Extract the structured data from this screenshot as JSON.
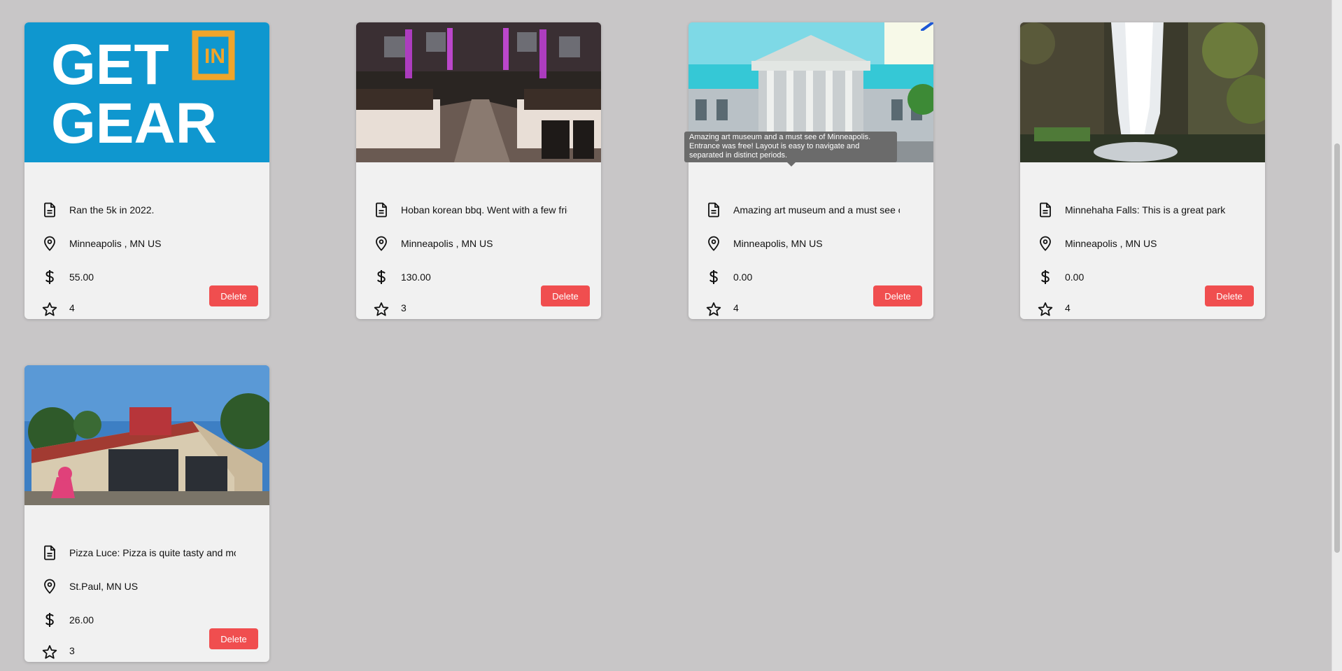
{
  "cards": [
    {
      "description": "Ran the 5k in 2022.",
      "location": "Minneapolis , MN US",
      "price": "55.00",
      "rating": "4",
      "delete_label": "Delete",
      "photo": {
        "logo_line1": "GET",
        "logo_badge": "IN",
        "logo_line2": "GEAR"
      }
    },
    {
      "description": "Hoban korean bbq. Went with a few friends",
      "location": "Minneapolis , MN US",
      "price": "130.00",
      "rating": "3",
      "delete_label": "Delete"
    },
    {
      "description": "Amazing art museum and a must see of Minneapolis.",
      "location": "Minneapolis, MN US",
      "price": "0.00",
      "rating": "4",
      "delete_label": "Delete",
      "tooltip": "Amazing art museum and a must see of Minneapolis. Entrance was free! Layout is easy to navigate and separated in distinct periods."
    },
    {
      "description": "Minnehaha Falls: This is a great park",
      "location": "Minneapolis , MN US",
      "price": "0.00",
      "rating": "4",
      "delete_label": "Delete"
    },
    {
      "description": "Pizza Luce: Pizza is quite tasty and more",
      "location": "St.Paul, MN US",
      "price": "26.00",
      "rating": "3",
      "delete_label": "Delete"
    }
  ],
  "icons": {
    "description": "document-icon",
    "location": "map-pin-icon",
    "price": "dollar-icon",
    "rating": "star-icon"
  },
  "colors": {
    "background": "#c8c6c7",
    "card": "#f1f1f1",
    "delete_button": "#f04e4f",
    "tooltip": "#6b6b6b"
  }
}
